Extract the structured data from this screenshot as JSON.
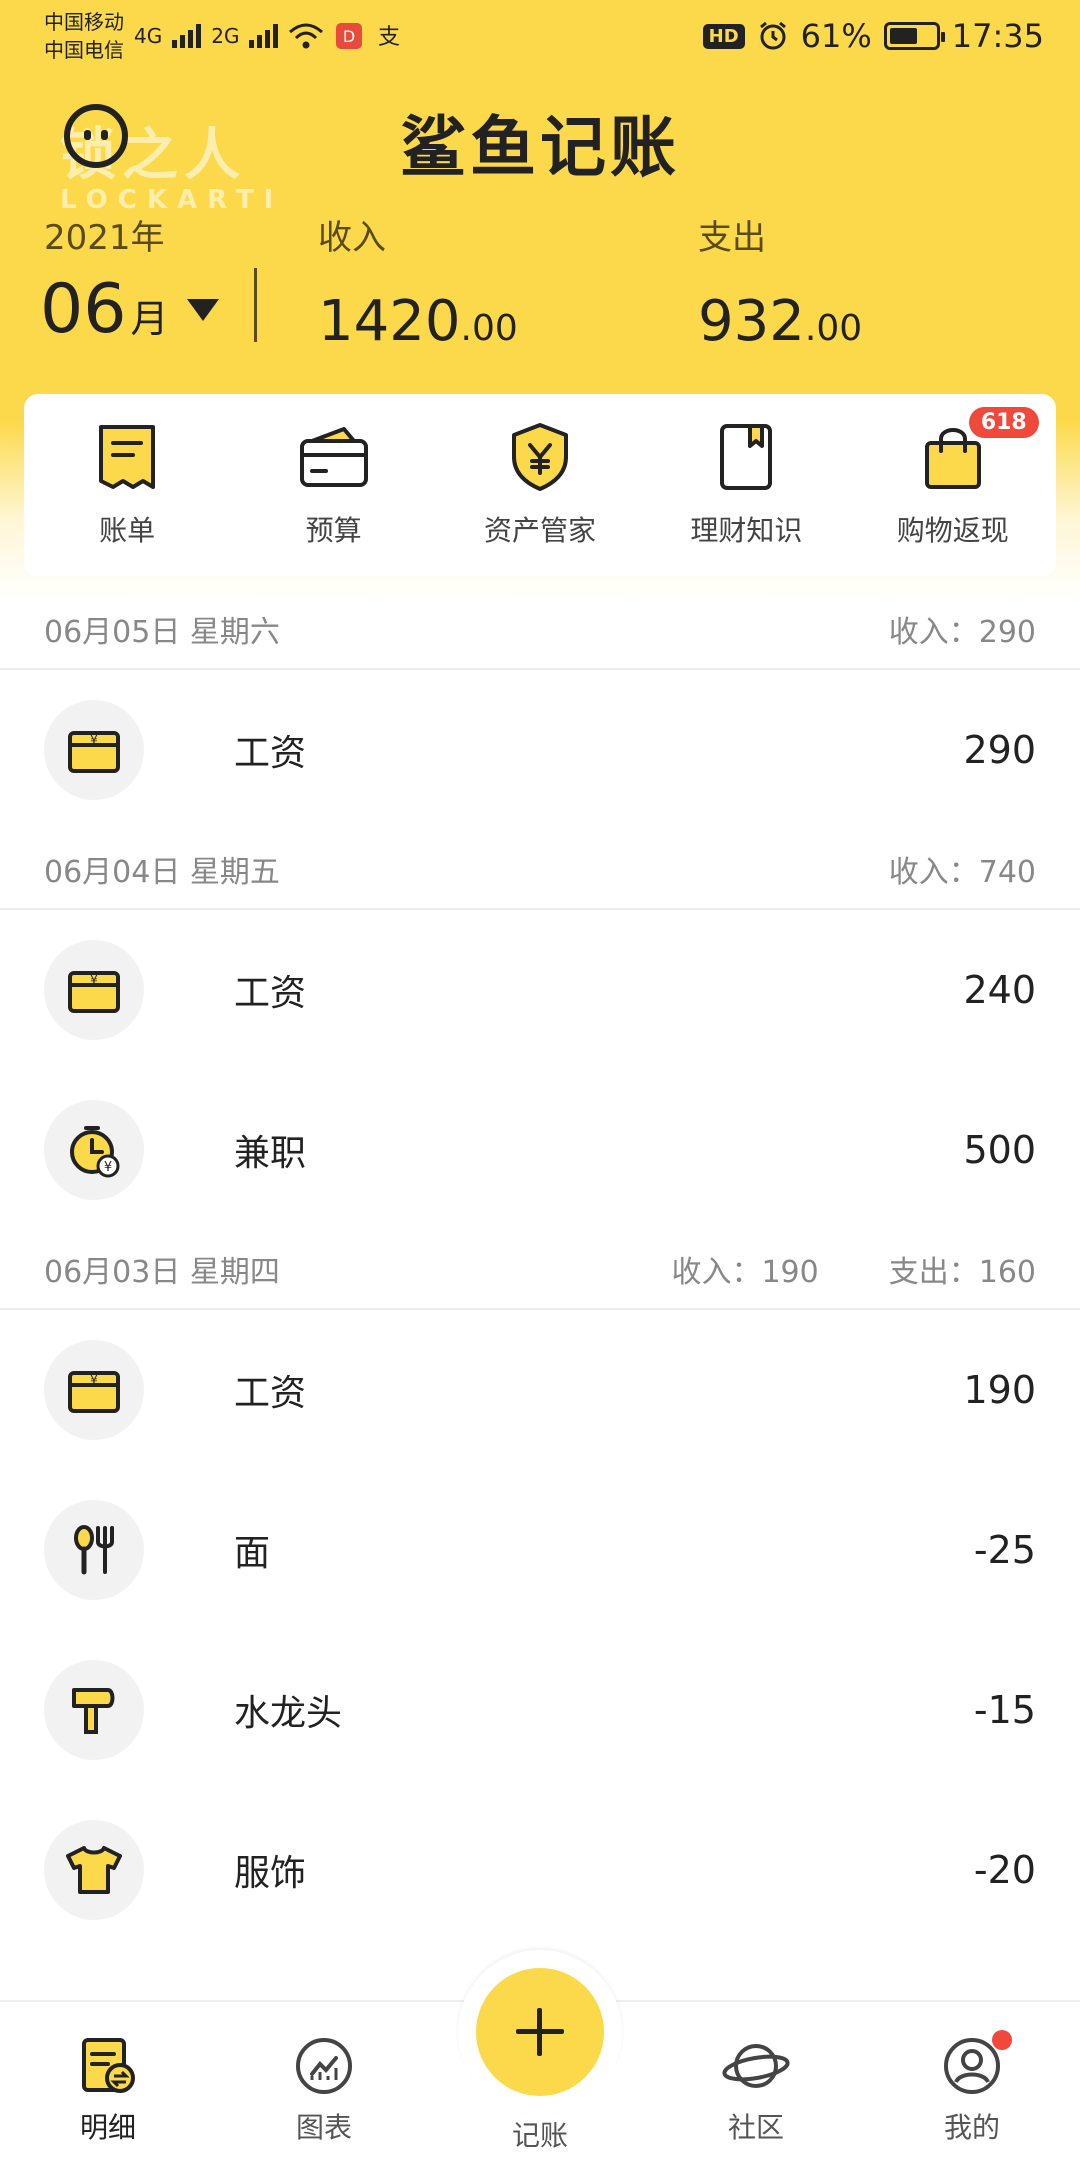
{
  "status_bar": {
    "carrier1": "中国移动",
    "carrier2": "中国电信",
    "net1": "4G",
    "net2": "2G",
    "hd": "HD",
    "battery_pct": "61%",
    "battery_level": 0.61,
    "time": "17:35"
  },
  "header": {
    "app_title": "鲨鱼记账",
    "watermark": "锁之人",
    "watermark_sub": "LOCKARTI"
  },
  "summary": {
    "year": "2021年",
    "month": "06",
    "month_unit": "月",
    "income_label": "收入",
    "income_int": "1420",
    "income_dec": ".00",
    "expense_label": "支出",
    "expense_int": "932",
    "expense_dec": ".00"
  },
  "quick_menu": [
    {
      "label": "账单",
      "icon": "bill-icon"
    },
    {
      "label": "预算",
      "icon": "wallet-icon"
    },
    {
      "label": "资产管家",
      "icon": "shield-yen-icon"
    },
    {
      "label": "理财知识",
      "icon": "book-icon"
    },
    {
      "label": "购物返现",
      "icon": "shopping-bag-icon",
      "badge": "618"
    }
  ],
  "days": [
    {
      "date": "06月05日 星期六",
      "income": "收入：290",
      "expense": "",
      "items": [
        {
          "name": "工资",
          "amount": "290",
          "icon": "salary-icon"
        }
      ]
    },
    {
      "date": "06月04日 星期五",
      "income": "收入：740",
      "expense": "",
      "items": [
        {
          "name": "工资",
          "amount": "240",
          "icon": "salary-icon"
        },
        {
          "name": "兼职",
          "amount": "500",
          "icon": "clock-yen-icon"
        }
      ]
    },
    {
      "date": "06月03日 星期四",
      "income": "收入：190",
      "expense": "支出：160",
      "items": [
        {
          "name": "工资",
          "amount": "190",
          "icon": "salary-icon"
        },
        {
          "name": "面",
          "amount": "-25",
          "icon": "utensils-icon"
        },
        {
          "name": "水龙头",
          "amount": "-15",
          "icon": "hammer-icon"
        },
        {
          "name": "服饰",
          "amount": "-20",
          "icon": "tshirt-icon"
        }
      ]
    }
  ],
  "bottom_nav": {
    "details": "明细",
    "charts": "图表",
    "add": "记账",
    "community": "社区",
    "mine": "我的"
  },
  "colors": {
    "brand_yellow": "#fcd94a",
    "badge_red": "#f0493c"
  }
}
